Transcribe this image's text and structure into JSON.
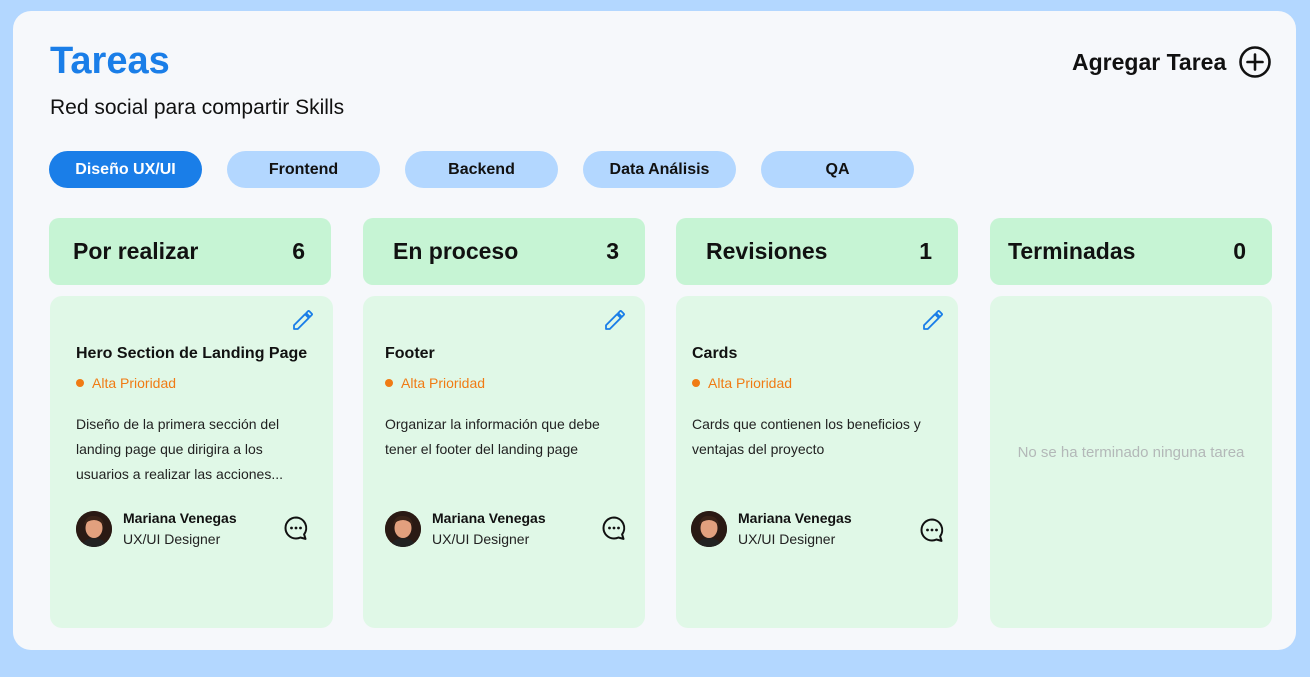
{
  "header": {
    "title": "Tareas",
    "subtitle": "Red social para compartir Skills",
    "add_task_label": "Agregar Tarea"
  },
  "tabs": [
    {
      "label": "Diseño UX/UI",
      "active": true
    },
    {
      "label": "Frontend",
      "active": false
    },
    {
      "label": "Backend",
      "active": false
    },
    {
      "label": "Data Análisis",
      "active": false
    },
    {
      "label": "QA",
      "active": false
    }
  ],
  "columns": [
    {
      "name": "Por realizar",
      "count": "6",
      "card": {
        "title": "Hero Section de Landing Page",
        "priority": "Alta Prioridad",
        "description": "Diseño de la primera sección del landing page que dirigira a los usuarios a realizar las acciones...",
        "user_name": "Mariana Venegas",
        "user_role": "UX/UI Designer"
      }
    },
    {
      "name": "En proceso",
      "count": "3",
      "card": {
        "title": "Footer",
        "priority": "Alta Prioridad",
        "description": "Organizar la información que debe tener el footer del landing page",
        "user_name": "Mariana Venegas",
        "user_role": "UX/UI Designer"
      }
    },
    {
      "name": "Revisiones",
      "count": "1",
      "card": {
        "title": "Cards",
        "priority": "Alta Prioridad",
        "description": "Cards que contienen los beneficios y ventajas del proyecto",
        "user_name": "Mariana Venegas",
        "user_role": "UX/UI Designer"
      }
    },
    {
      "name": "Terminadas",
      "count": "0",
      "empty_message": "No se ha terminado ninguna tarea"
    }
  ],
  "colors": {
    "background": "#b3d7ff",
    "accent": "#1a7ee8",
    "column_header": "#c6f4d4",
    "card": "#e0f8e7",
    "priority": "#f07b14"
  },
  "icons": [
    "plus-circle-icon",
    "pencil-icon",
    "chat-bubble-icon",
    "avatar"
  ]
}
